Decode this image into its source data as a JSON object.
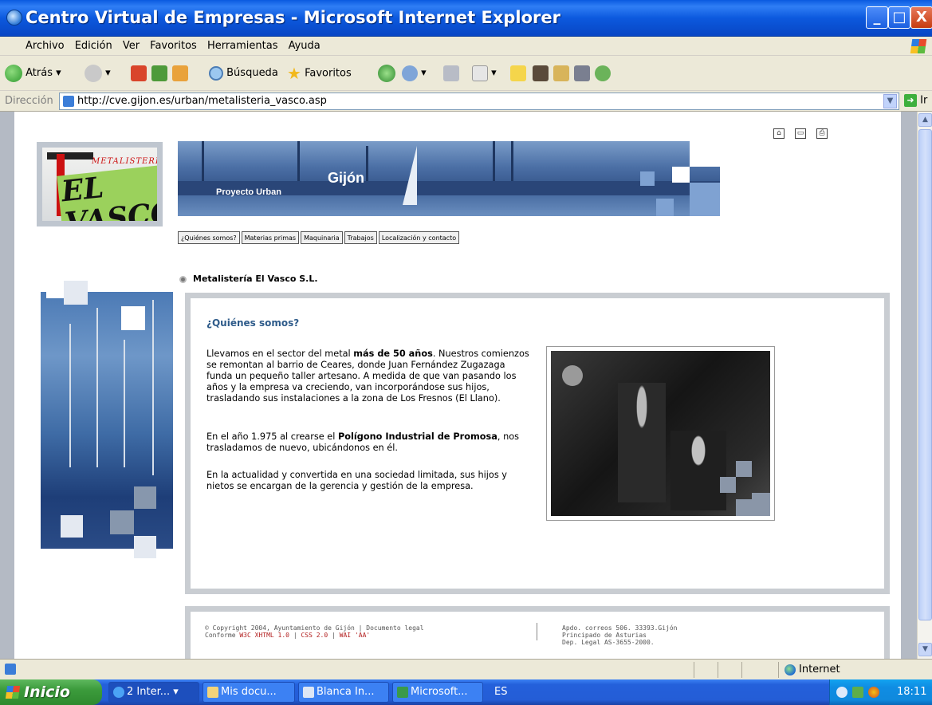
{
  "window": {
    "title": "Centro Virtual de Empresas - Microsoft Internet Explorer",
    "minimize": "_",
    "maximize": "□",
    "close": "X"
  },
  "menu": [
    "Archivo",
    "Edición",
    "Ver",
    "Favoritos",
    "Herramientas",
    "Ayuda"
  ],
  "toolbar": {
    "back_label": "Atrás",
    "search_label": "Búsqueda",
    "favorites_label": "Favoritos"
  },
  "address": {
    "label": "Dirección",
    "url": "http://cve.gijon.es/urban/metalisteria_vasco.asp",
    "go_label": "Ir"
  },
  "page": {
    "logo": {
      "small_text": "METALISTERÍA",
      "big_text": "EL VASCO"
    },
    "banner": {
      "city": "Gijón",
      "project": "Proyecto Urban"
    },
    "nav_tabs": [
      "¿Quiénes somos?",
      "Materias primas",
      "Maquinaria",
      "Trabajos",
      "Localización y contacto"
    ],
    "company_name": "Metalistería El Vasco S.L.",
    "section_title": "¿Quiénes somos?",
    "p1": {
      "a": "Llevamos en el sector del metal ",
      "b": "más de 50 años",
      "c": ". Nuestros comienzos se remontan al barrio de Ceares, donde Juan Fernández Zugazaga funda un pequeño taller artesano. A medida de que van pasando los años y la empresa va creciendo, van incorporándose sus hijos, trasladando sus instalaciones a la zona de Los Fresnos (El Llano)."
    },
    "p2": {
      "a": "En el año 1.975 al crearse el ",
      "b": "Polígono Industrial de Promosa",
      "c": ", nos trasladamos de nuevo, ubicándonos en él."
    },
    "p3": "En la actualidad y convertida en una sociedad limitada, sus hijos y nietos se encargan de la gerencia y gestión de la empresa.",
    "footer": {
      "copyright": "© Copyright 2004, Ayuntamiento de Gijón | Documento legal",
      "conforme": "Conforme",
      "xhtml": "W3C XHTML 1.0",
      "sep": "|",
      "css": "CSS 2.0",
      "wai": "WAI 'AA'",
      "addr1": "Apdo. correos 506. 33393.Gijón",
      "addr2": "Principado de Asturias",
      "addr3": "Dep. Legal AS-3655-2000."
    }
  },
  "status": {
    "zone": "Internet"
  },
  "taskbar": {
    "start": "Inicio",
    "tasks": [
      "2 Inter...",
      "Mis docu...",
      "Blanca In...",
      "Microsoft..."
    ],
    "lang": "ES",
    "clock": "18:11"
  },
  "colors": {
    "xp_blue": "#0C59DE",
    "link_red": "#B21E1E",
    "section_title": "#2E5B8A",
    "card_border": "#C9CDD2"
  }
}
